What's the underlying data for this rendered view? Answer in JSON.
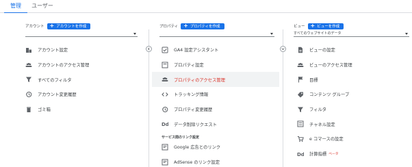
{
  "tabs": {
    "admin": "管理",
    "user": "ユーザー"
  },
  "account": {
    "label": "アカウント",
    "create": "アカウントを作成",
    "selected": "",
    "items": [
      {
        "label": "アカウント設定",
        "icon": "building-icon"
      },
      {
        "label": "アカウントのアクセス管理",
        "icon": "people-icon"
      },
      {
        "label": "すべてのフィルタ",
        "icon": "filter-icon"
      },
      {
        "label": "アカウント変更履歴",
        "icon": "history-icon"
      },
      {
        "label": "ゴミ箱",
        "icon": "trash-icon"
      }
    ]
  },
  "property": {
    "label": "プロパティ",
    "create": "プロパティを作成",
    "selected": "",
    "items": [
      {
        "label": "GA4 設定アシスタント",
        "icon": "checkbox-icon"
      },
      {
        "label": "プロパティ設定",
        "icon": "property-settings-icon"
      },
      {
        "label": "プロパティのアクセス管理",
        "icon": "people-icon",
        "active": true
      },
      {
        "label": "トラッキング情報",
        "icon": "code-icon"
      },
      {
        "label": "プロパティ変更履歴",
        "icon": "history-icon"
      },
      {
        "label": "データ削除リクエスト",
        "icon": "dd-icon"
      }
    ],
    "section_title": "サービス間のリンク設定",
    "link_items": [
      {
        "label": "Google 広告とのリンク",
        "icon": "google-ads-icon"
      },
      {
        "label": "AdSense のリンク設定",
        "icon": "adsense-icon"
      }
    ]
  },
  "view": {
    "label": "ビュー",
    "create": "ビューを作成",
    "selected": "すべてのウェブサイトのデータ",
    "items": [
      {
        "label": "ビューの設定",
        "icon": "document-icon"
      },
      {
        "label": "ビューのアクセス管理",
        "icon": "people-icon"
      },
      {
        "label": "目標",
        "icon": "flag-icon"
      },
      {
        "label": "コンテンツ グループ",
        "icon": "content-group-icon"
      },
      {
        "label": "フィルタ",
        "icon": "filter-icon"
      },
      {
        "label": "チャネル設定",
        "icon": "channel-settings-icon"
      },
      {
        "label": "e コマースの設定",
        "icon": "cart-icon"
      },
      {
        "label": "計算指標",
        "icon": "dd-icon",
        "badge": "ベータ"
      }
    ]
  }
}
